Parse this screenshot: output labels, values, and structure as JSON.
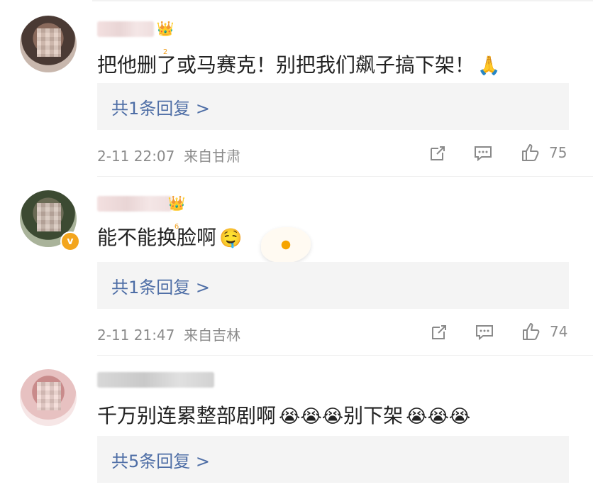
{
  "comments": [
    {
      "user_level": "2",
      "text": "把他删了或马赛克！别把我们飙子搞下架！",
      "emoji": "🙏",
      "reply_label": "共1条回复 >",
      "time": "2-11 22:07",
      "location": "来自甘肃",
      "likes": "75"
    },
    {
      "user_level": "6",
      "text": "能不能换脸啊",
      "emoji": "🤤",
      "reply_label": "共1条回复 >",
      "time": "2-11 21:47",
      "location": "来自吉林",
      "likes": "74"
    },
    {
      "text": "千万别连累整部剧啊",
      "emojis_before": "😭😭😭",
      "text_after": "别下架",
      "emojis_after": "😭😭😭",
      "reply_label": "共5条回复 >"
    }
  ],
  "icons": [
    "share-icon",
    "comment-icon",
    "like-icon"
  ],
  "colors": {
    "reply_link": "#4e6ea6",
    "meta_text": "#8b8b8b",
    "reply_bg": "#f4f4f4",
    "vip_badge": "#f3a51d"
  }
}
